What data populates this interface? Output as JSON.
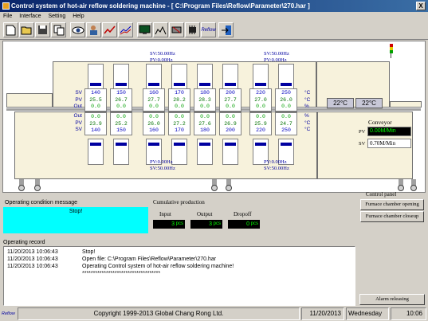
{
  "window": {
    "title": "Control system of hot-air reflow soldering machine - [ C:\\Program Files\\Reflow\\Parameter\\270.har ]",
    "close_label": "X"
  },
  "menu": [
    "File",
    "Interface",
    "Setting",
    "Help"
  ],
  "toolbar": {
    "icons": [
      "new-file",
      "open-folder",
      "save",
      "copy-pages",
      "view-eye",
      "operator",
      "chart",
      "monitor",
      "chip-profile",
      "sensor",
      "chip",
      "reflow-logo",
      "exit"
    ],
    "reflow_label": "Reflow"
  },
  "top_fan": {
    "left": {
      "sv": "SV:50.00Hz",
      "pv": "PV:0.00Hz"
    },
    "right": {
      "sv": "SV:50.00Hz",
      "pv": "PV:0.00Hz"
    }
  },
  "bottom_fan": {
    "left": {
      "pv": "PV:0.00Hz",
      "sv": "SV:50.00Hz"
    },
    "right": {
      "pv": "PV:0.00Hz",
      "sv": "SV:50.00Hz"
    }
  },
  "row_labels": {
    "sv": "SV",
    "pv": "PV",
    "out": "Out",
    "unit_c": "°C",
    "unit_pct": "%"
  },
  "upper_zones": [
    {
      "sv": "140",
      "pv": "25.5",
      "out": "0.0"
    },
    {
      "sv": "150",
      "pv": "26.7",
      "out": "0.0"
    },
    {
      "sv": "160",
      "pv": "27.7",
      "out": "0.0"
    },
    {
      "sv": "170",
      "pv": "28.2",
      "out": "0.0"
    },
    {
      "sv": "180",
      "pv": "28.3",
      "out": "0.0"
    },
    {
      "sv": "200",
      "pv": "27.7",
      "out": "0.0"
    },
    {
      "sv": "220",
      "pv": "27.0",
      "out": "0.0"
    },
    {
      "sv": "250",
      "pv": "26.0",
      "out": "0.0"
    }
  ],
  "lower_zones": [
    {
      "out": "0.0",
      "pv": "23.9",
      "sv": "140"
    },
    {
      "out": "0.0",
      "pv": "25.2",
      "sv": "150"
    },
    {
      "out": "0.0",
      "pv": "26.0",
      "sv": "160"
    },
    {
      "out": "0.0",
      "pv": "27.2",
      "sv": "170"
    },
    {
      "out": "0.0",
      "pv": "27.6",
      "sv": "180"
    },
    {
      "out": "0.0",
      "pv": "26.9",
      "sv": "200"
    },
    {
      "out": "0.0",
      "pv": "25.9",
      "sv": "220"
    },
    {
      "out": "0.0",
      "pv": "24.7",
      "sv": "250"
    }
  ],
  "cooling": [
    "22°C",
    "22°C"
  ],
  "conveyor": {
    "title": "Conveyor",
    "pv_label": "PV",
    "pv_value": "0.00M/Min",
    "sv_label": "SV",
    "sv_value": "0.70M/Min"
  },
  "operating_condition": {
    "title": "Operating condition message",
    "message": "Stop!"
  },
  "production": {
    "title": "Cumulative production",
    "input_label": "Input",
    "output_label": "Output",
    "dropoff_label": "Dropoff",
    "input": "3",
    "output": "3",
    "dropoff": "0",
    "unit": "pcs"
  },
  "control_panel": {
    "title": "Control panel",
    "open_label": "Furnace chamber opening",
    "close_label": "Furnace chamber closeup"
  },
  "operating_record": {
    "title": "Operating record",
    "rows": [
      {
        "time": "11/20/2013 10:06:43",
        "text": "Stop!"
      },
      {
        "time": "11/20/2013 10:06:43",
        "text": "Open file: C:\\Program Files\\Reflow\\Parameter\\270.har"
      },
      {
        "time": "11/20/2013 10:06:43",
        "text": "Operating Control system of hot-air reflow soldering machine!"
      },
      {
        "time": "",
        "text": "************************************"
      }
    ]
  },
  "alarm_label": "Alarm releasing",
  "status": {
    "logo": "Reflow",
    "copyright": "Copyright 1999-2013 Global Chang Rong Ltd.",
    "date": "11/20/2013",
    "day": "Wednesday",
    "time": "10:06"
  }
}
